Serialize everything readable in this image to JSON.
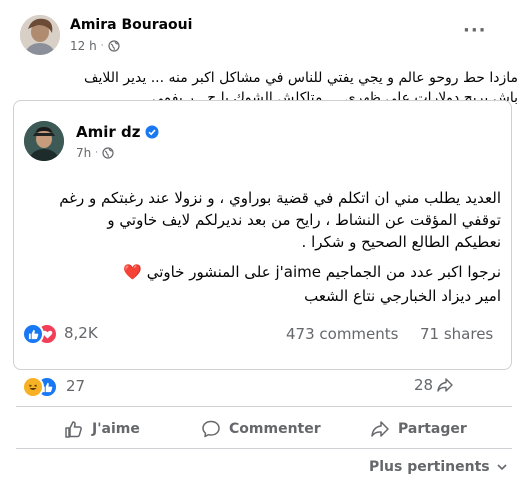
{
  "outer_post": {
    "author": "Amira Bouraoui",
    "time": "12 h",
    "text_line1": "مازدا حط روحو عالم  و يجي يفتي للناس في مشاكل اكبر منه ...  يدير اللايف",
    "text_line2": "باش يربح دولارات على ظهري ... متاكلش الشوك يا ح...ر  بفمي"
  },
  "shared_post": {
    "author": "Amir dz",
    "time": "7h",
    "lines": [
      "العديد يطلب مني ان اتكلم في قضية بوراوي ، و نزولا عند رغبتكم و رغم",
      "توقفي المؤقت عن النشاط ، رايح من بعد نديرلكم لايف خاوتي و",
      "نعطيكم الطالع الصحيح و شكرا .",
      "نرجوا اكبر عدد من الجماجيم j'aime على المنشور خاوتي ❤️",
      "امير ديزاد الخبارجي نتاع الشعب"
    ],
    "reactions_count": "8,2K",
    "comments": "473 comments",
    "shares": "71 shares"
  },
  "outer_stats": {
    "reactions_count": "27",
    "shares_count": "28"
  },
  "actions": {
    "like": "J'aime",
    "comment": "Commenter",
    "share": "Partager"
  },
  "sort_label": "Plus pertinents",
  "colors": {
    "like_blue": "#1877f2",
    "love_red": "#f33e58",
    "haha_yellow": "#f7b125",
    "secondary_text": "#65676b",
    "border": "#ced0d4"
  }
}
